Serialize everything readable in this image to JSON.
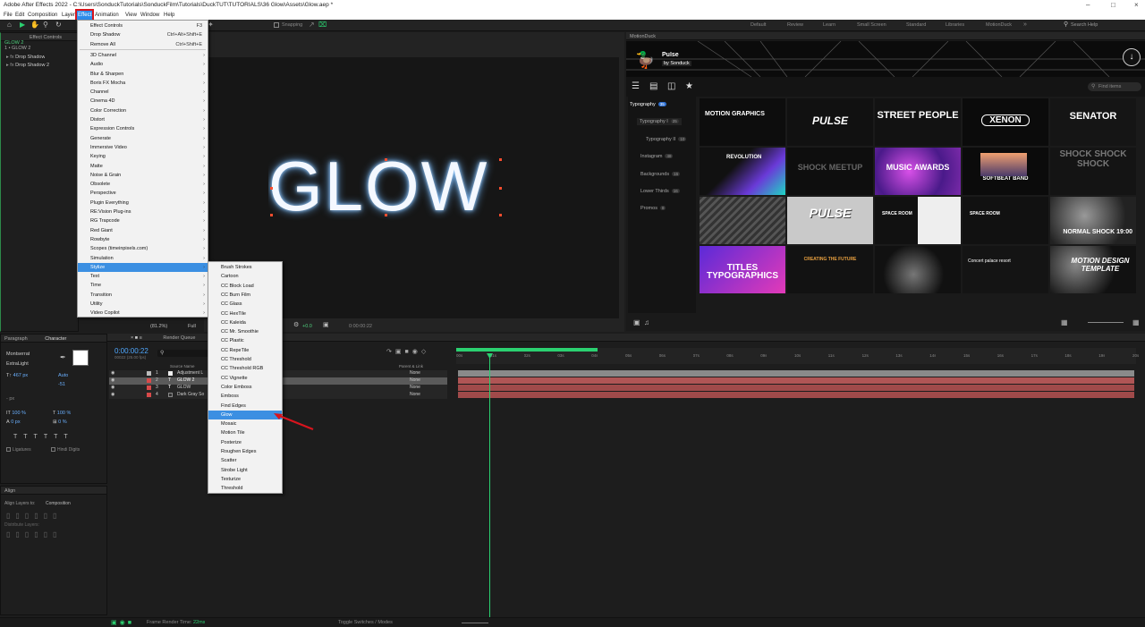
{
  "window": {
    "title": "Adobe After Effects 2022 - C:\\Users\\SonduckTutorials\\SonduckFilm\\Tutorials\\DuckTUT\\TUTORIALS\\36 Glow\\Assets\\Glow.aep *"
  },
  "menubar": {
    "file": "File",
    "edit": "Edit",
    "composition": "Composition",
    "layer": "Layer",
    "effect": "Effect",
    "animation": "Animation",
    "view": "View",
    "window": "Window",
    "help": "Help"
  },
  "toolbar": {
    "snapping": "Snapping",
    "workspaces": [
      "Default",
      "Review",
      "Learn",
      "Small Screen",
      "Standard",
      "Libraries",
      "MotionDuck"
    ],
    "search": "Search Help"
  },
  "effect_controls": {
    "tab": "Effect Controls",
    "layer": "GLOW 2",
    "crumb": "1 • GLOW 2",
    "items": [
      "Drop Shadow",
      "Drop Shadow 2"
    ]
  },
  "effect_menu": [
    {
      "label": "Effect Controls",
      "shortcut": "F3"
    },
    {
      "label": "Drop Shadow",
      "shortcut": "Ctrl+Alt+Shift+E"
    },
    {
      "label": "Remove All",
      "shortcut": "Ctrl+Shift+E"
    },
    {
      "label": "3D Channel",
      "sub": true
    },
    {
      "label": "Audio",
      "sub": true
    },
    {
      "label": "Blur & Sharpen",
      "sub": true
    },
    {
      "label": "Boris FX Mocha",
      "sub": true
    },
    {
      "label": "Channel",
      "sub": true
    },
    {
      "label": "Cinema 4D",
      "sub": true
    },
    {
      "label": "Color Correction",
      "sub": true
    },
    {
      "label": "Distort",
      "sub": true
    },
    {
      "label": "Expression Controls",
      "sub": true
    },
    {
      "label": "Generate",
      "sub": true
    },
    {
      "label": "Immersive Video",
      "sub": true
    },
    {
      "label": "Keying",
      "sub": true
    },
    {
      "label": "Matte",
      "sub": true
    },
    {
      "label": "Noise & Grain",
      "sub": true
    },
    {
      "label": "Obsolete",
      "sub": true
    },
    {
      "label": "Perspective",
      "sub": true
    },
    {
      "label": "Plugin Everything",
      "sub": true
    },
    {
      "label": "RE:Vision Plug-ins",
      "sub": true
    },
    {
      "label": "RG Trapcode",
      "sub": true
    },
    {
      "label": "Red Giant",
      "sub": true
    },
    {
      "label": "Rowbyte",
      "sub": true
    },
    {
      "label": "Scopes (timeinpixels.com)",
      "sub": true
    },
    {
      "label": "Simulation",
      "sub": true
    },
    {
      "label": "Stylize",
      "sub": true
    },
    {
      "label": "Text",
      "sub": true
    },
    {
      "label": "Time",
      "sub": true
    },
    {
      "label": "Transition",
      "sub": true
    },
    {
      "label": "Utility",
      "sub": true
    },
    {
      "label": "Video Copilot",
      "sub": true
    }
  ],
  "stylize_menu": [
    "Brush Strokes",
    "Cartoon",
    "CC Block Load",
    "CC Burn Film",
    "CC Glass",
    "CC HexTile",
    "CC Kaleida",
    "CC Mr. Smoothie",
    "CC Plastic",
    "CC RepeTile",
    "CC Threshold",
    "CC Threshold RGB",
    "CC Vignette",
    "Color Emboss",
    "Emboss",
    "Find Edges",
    "Glow",
    "Mosaic",
    "Motion Tile",
    "Posterize",
    "Roughen Edges",
    "Scatter",
    "Strobe Light",
    "Texturize",
    "Threshold"
  ],
  "comp": {
    "text": "GLOW",
    "zoom": "(81.2%)",
    "res": "Full",
    "time": "0:00:00:22",
    "exposure": "+0.0"
  },
  "motionduck": {
    "panel": "MotionDuck",
    "title": "Pulse",
    "by": "by Sonduck",
    "search": "Find items",
    "categories": [
      {
        "label": "Typography",
        "count": "35"
      },
      {
        "label": "Typography I",
        "count": "25"
      },
      {
        "label": "Typography II",
        "count": "10"
      },
      {
        "label": "Instagram",
        "count": "48"
      },
      {
        "label": "Backgrounds",
        "count": "16"
      },
      {
        "label": "Lower Thirds",
        "count": "16"
      },
      {
        "label": "Promos",
        "count": "8"
      }
    ],
    "tiles": [
      "MOTION GRAPHICS",
      "PULSE",
      "STREET PEOPLE",
      "XENON",
      "SENATOR",
      "REVOLUTION",
      "SHOCK MEETUP",
      "MUSIC AWARDS",
      "SOFTBEAT BAND",
      "SHOCK SHOCK SHOCK",
      "",
      "PULSE",
      "SPACE ROOM",
      "SPACE ROOM",
      "NORMAL SHOCK 19:00",
      "TITLES TYPOGRAPHICS",
      "CREATING THE FUTURE",
      "",
      "Concert palace resort",
      "MOTION DESIGN TEMPLATE"
    ]
  },
  "character": {
    "tab1": "Paragraph",
    "tab2": "Character",
    "font": "Montserrat",
    "style": "ExtraLight",
    "size": "467 px",
    "leading": "Auto",
    "tracking": "-51",
    "unit": "- px",
    "scale_v": "100 %",
    "scale_h": "100 %",
    "baseline": "0 px",
    "tsume": "0 %",
    "ligatures": "Ligatures",
    "hindi": "Hindi Digits"
  },
  "align": {
    "tab": "Align",
    "label": "Align Layers to:",
    "target": "Composition",
    "distribute": "Distribute Layers:"
  },
  "timeline": {
    "timecode": "0:00:00:22",
    "frames": "00022 (25.00 fps)",
    "render_queue": "Render Queue",
    "col_source": "Source Name",
    "col_parent": "Parent & Link",
    "layers": [
      {
        "num": "1",
        "name": "Adjustment L",
        "parent": "None"
      },
      {
        "num": "2",
        "name": "GLOW 2",
        "parent": "None"
      },
      {
        "num": "3",
        "name": "GLOW",
        "parent": "None"
      },
      {
        "num": "4",
        "name": "Dark Gray So",
        "parent": "None"
      }
    ],
    "ruler": [
      "00s",
      "01s",
      "02s",
      "03s",
      "04s",
      "05s",
      "06s",
      "07s",
      "08s",
      "09s",
      "10s",
      "11s",
      "12s",
      "13s",
      "14s",
      "15s",
      "16s",
      "17s",
      "18s",
      "19s",
      "20s"
    ]
  },
  "status": {
    "render_label": "Frame Render Time:",
    "render_value": "22ms",
    "toggle": "Toggle Switches / Modes"
  },
  "colors": {
    "accent": "#2d8ceb",
    "highlight": "#3b8fe2",
    "annotation": "#d8141d",
    "bar_main": "#a04a4a",
    "bar_adj": "#8a8a8a"
  }
}
